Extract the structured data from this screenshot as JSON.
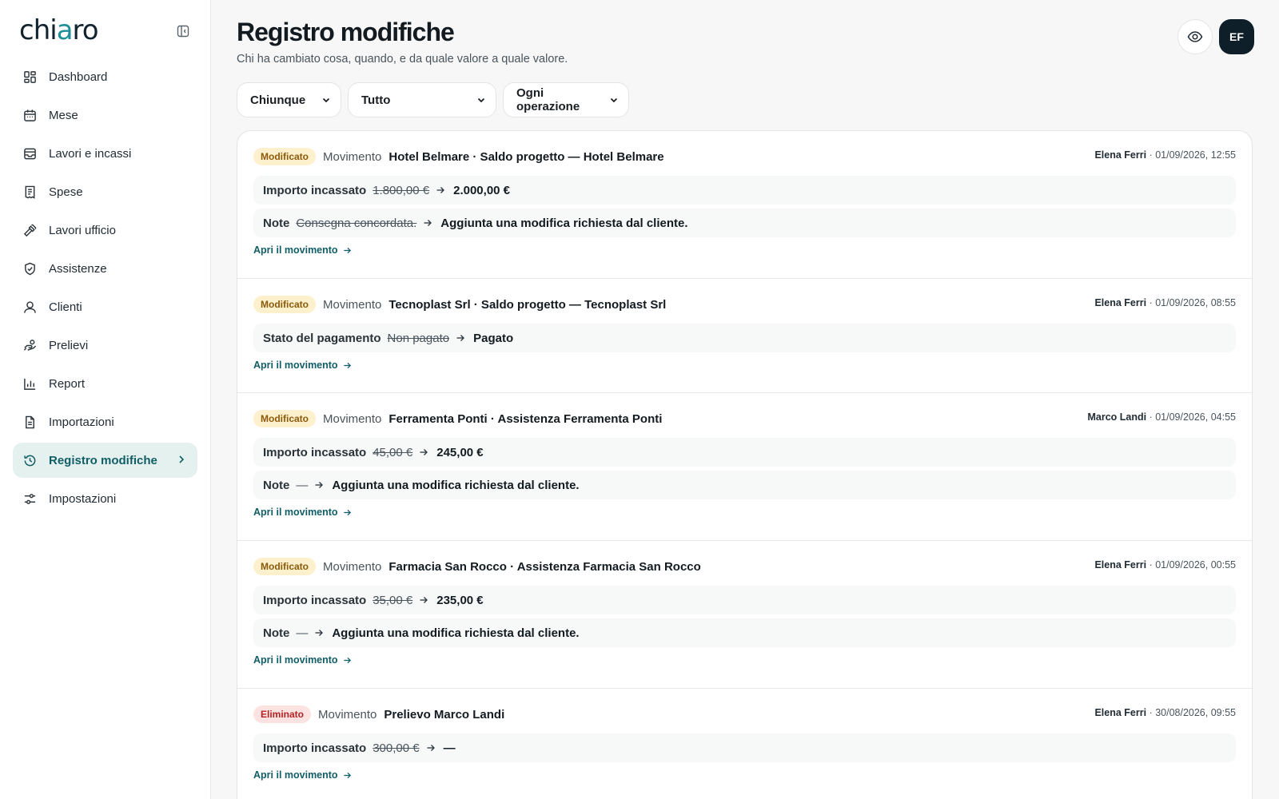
{
  "app": {
    "logo_pre": "chi",
    "logo_accent": "a",
    "logo_post": "ro"
  },
  "sidebar": {
    "items": [
      {
        "label": "Dashboard",
        "icon": "dashboard-icon"
      },
      {
        "label": "Mese",
        "icon": "calendar-icon"
      },
      {
        "label": "Lavori e incassi",
        "icon": "inbox-icon"
      },
      {
        "label": "Spese",
        "icon": "receipt-icon"
      },
      {
        "label": "Lavori ufficio",
        "icon": "hammer-icon"
      },
      {
        "label": "Assistenze",
        "icon": "shield-icon"
      },
      {
        "label": "Clienti",
        "icon": "user-icon"
      },
      {
        "label": "Prelievi",
        "icon": "withdraw-icon"
      },
      {
        "label": "Report",
        "icon": "bar-chart-icon"
      },
      {
        "label": "Importazioni",
        "icon": "file-import-icon"
      },
      {
        "label": "Registro modifiche",
        "icon": "history-icon",
        "active": true
      },
      {
        "label": "Impostazioni",
        "icon": "sliders-icon"
      }
    ]
  },
  "header": {
    "title": "Registro modifiche",
    "subtitle": "Chi ha cambiato cosa, quando, e da quale valore a quale valore.",
    "avatar_initials": "EF"
  },
  "filters": {
    "user": "Chiunque",
    "period": "Tutto",
    "operation": "Ogni operazione"
  },
  "entries": [
    {
      "badge": "Modificato",
      "entity": "Movimento",
      "title": "Hotel Belmare · Saldo progetto — Hotel Belmare",
      "author": "Elena Ferri",
      "datetime": " · 01/09/2026, 12:55",
      "changes": [
        {
          "field": "Importo incassato",
          "old": "1.800,00 €",
          "new": "2.000,00 €"
        },
        {
          "field": "Note",
          "old": "Consegna concordata.",
          "new": "Aggiunta una modifica richiesta dal cliente."
        }
      ],
      "link": "Apri il movimento"
    },
    {
      "badge": "Modificato",
      "entity": "Movimento",
      "title": "Tecnoplast Srl · Saldo progetto — Tecnoplast Srl",
      "author": "Elena Ferri",
      "datetime": " · 01/09/2026, 08:55",
      "changes": [
        {
          "field": "Stato del pagamento",
          "old": "Non pagato",
          "new": "Pagato"
        }
      ],
      "link": "Apri il movimento"
    },
    {
      "badge": "Modificato",
      "entity": "Movimento",
      "title": "Ferramenta Ponti · Assistenza Ferramenta Ponti",
      "author": "Marco Landi",
      "datetime": " · 01/09/2026, 04:55",
      "changes": [
        {
          "field": "Importo incassato",
          "old": "45,00 €",
          "new": "245,00 €"
        },
        {
          "field": "Note",
          "old": "—",
          "new": "Aggiunta una modifica richiesta dal cliente."
        }
      ],
      "link": "Apri il movimento"
    },
    {
      "badge": "Modificato",
      "entity": "Movimento",
      "title": "Farmacia San Rocco · Assistenza Farmacia San Rocco",
      "author": "Elena Ferri",
      "datetime": " · 01/09/2026, 00:55",
      "changes": [
        {
          "field": "Importo incassato",
          "old": "35,00 €",
          "new": "235,00 €"
        },
        {
          "field": "Note",
          "old": "—",
          "new": "Aggiunta una modifica richiesta dal cliente."
        }
      ],
      "link": "Apri il movimento"
    },
    {
      "badge": "Eliminato",
      "entity": "Movimento",
      "title": "Prelievo Marco Landi",
      "author": "Elena Ferri",
      "datetime": " · 30/08/2026, 09:55",
      "changes": [
        {
          "field": "Importo incassato",
          "old": "300,00 €",
          "new": "—"
        }
      ],
      "link": "Apri il movimento"
    }
  ],
  "colors": {
    "accent": "#125e66",
    "active_bg": "#e4f1ef",
    "badge_modified_bg": "#fdf0cc",
    "badge_deleted_bg": "#fde2e2"
  }
}
